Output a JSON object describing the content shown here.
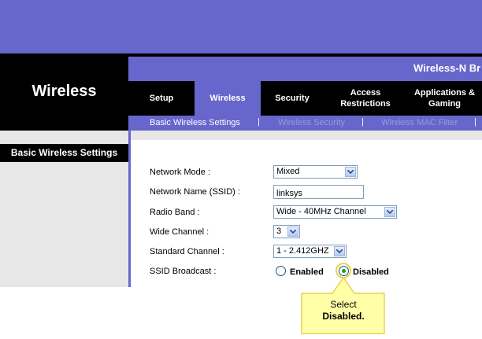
{
  "header": {
    "page_title": "Wireless",
    "product_name": "Wireless-N Br"
  },
  "tabs": [
    {
      "label": "Setup"
    },
    {
      "label": "Wireless"
    },
    {
      "label": "Security"
    },
    {
      "label": "Access Restrictions"
    },
    {
      "label": "Applications & Gaming"
    }
  ],
  "subtabs": [
    {
      "label": "Basic Wireless Settings"
    },
    {
      "label": "Wireless Security"
    },
    {
      "label": "Wireless MAC Filter"
    }
  ],
  "section": {
    "title": "Basic Wireless Settings"
  },
  "form": {
    "network_mode": {
      "label": "Network Mode :",
      "value": "Mixed"
    },
    "ssid": {
      "label": "Network Name (SSID) :",
      "value": "linksys"
    },
    "radio_band": {
      "label": "Radio Band :",
      "value": "Wide - 40MHz Channel"
    },
    "wide_channel": {
      "label": "Wide Channel :",
      "value": "3"
    },
    "standard_channel": {
      "label": "Standard Channel :",
      "value": "1 - 2.412GHZ"
    },
    "ssid_broadcast": {
      "label": "SSID Broadcast :",
      "options": [
        "Enabled",
        "Disabled"
      ],
      "selected": "Disabled"
    }
  },
  "callout": {
    "line1": "Select",
    "line2": "Disabled."
  },
  "colors": {
    "brand": "#6666cc",
    "header_black": "#000000",
    "callout": "#ffffa8"
  }
}
